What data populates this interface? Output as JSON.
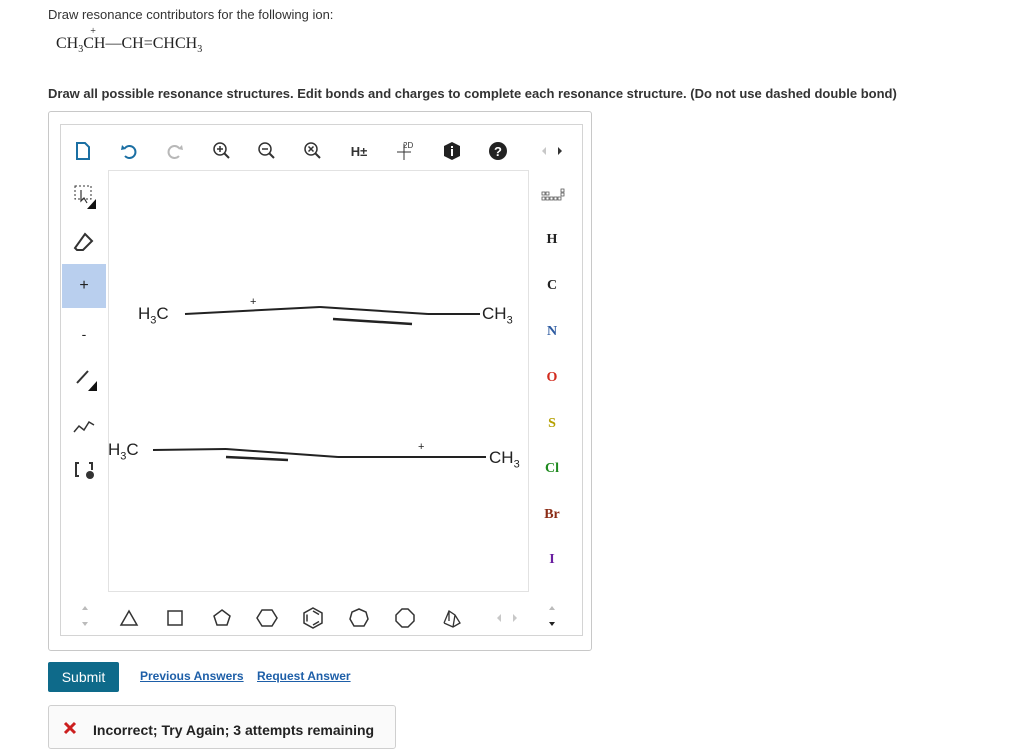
{
  "question": {
    "prompt": "Draw resonance contributors for the following ion:",
    "formula": {
      "part1": "CH",
      "sub1": "3",
      "charged_atom": "CH",
      "charge": "+",
      "part2": "—CH",
      "double_bond": "=",
      "part3": "CHCH",
      "sub3": "3"
    },
    "instruction": "Draw all possible resonance structures. Edit bonds and charges to complete each resonance structure. (Do not use dashed double bond)"
  },
  "toolbar": {
    "icons": [
      "new-document-icon",
      "undo-icon",
      "redo-icon",
      "zoom-in-icon",
      "zoom-out-icon",
      "zoom-reset-icon",
      "hydrogen-toggle-icon",
      "2d-clean-icon",
      "info-icon",
      "help-icon",
      "more-arrows-icon"
    ],
    "h_toggle_label": "H±",
    "clean_label": "2D"
  },
  "left_tools": [
    "selection-lasso-icon",
    "eraser-icon",
    "positive-charge-icon",
    "negative-charge-icon",
    "single-bond-icon",
    "chain-icon",
    "bracket-icon"
  ],
  "left_labels": {
    "plus": "+",
    "minus": "-"
  },
  "elements": [
    {
      "symbol": "H",
      "color": "#333333"
    },
    {
      "symbol": "C",
      "color": "#222222"
    },
    {
      "symbol": "N",
      "color": "#2c5aa0"
    },
    {
      "symbol": "O",
      "color": "#d22a1d"
    },
    {
      "symbol": "S",
      "color": "#b5a000"
    },
    {
      "symbol": "Cl",
      "color": "#1f8a1f"
    },
    {
      "symbol": "Br",
      "color": "#8b2c16"
    },
    {
      "symbol": "I",
      "color": "#6a1fa0"
    }
  ],
  "structures": [
    {
      "left": "H",
      "left_sub": "3",
      "left_c": "C",
      "right": "CH",
      "right_sub": "3",
      "charge": "+"
    },
    {
      "left": "H",
      "left_sub": "3",
      "left_c": "C",
      "right": "CH",
      "right_sub": "3",
      "charge": "+"
    }
  ],
  "actions": {
    "submit_label": "Submit",
    "previous_answers_label": "Previous Answers",
    "request_answer_label": "Request Answer"
  },
  "feedback": {
    "icon": "x-mark-icon",
    "text": "Incorrect; Try Again; 3 attempts remaining",
    "color": "#cc1f1f"
  },
  "accent_color": "#0e6a8a"
}
